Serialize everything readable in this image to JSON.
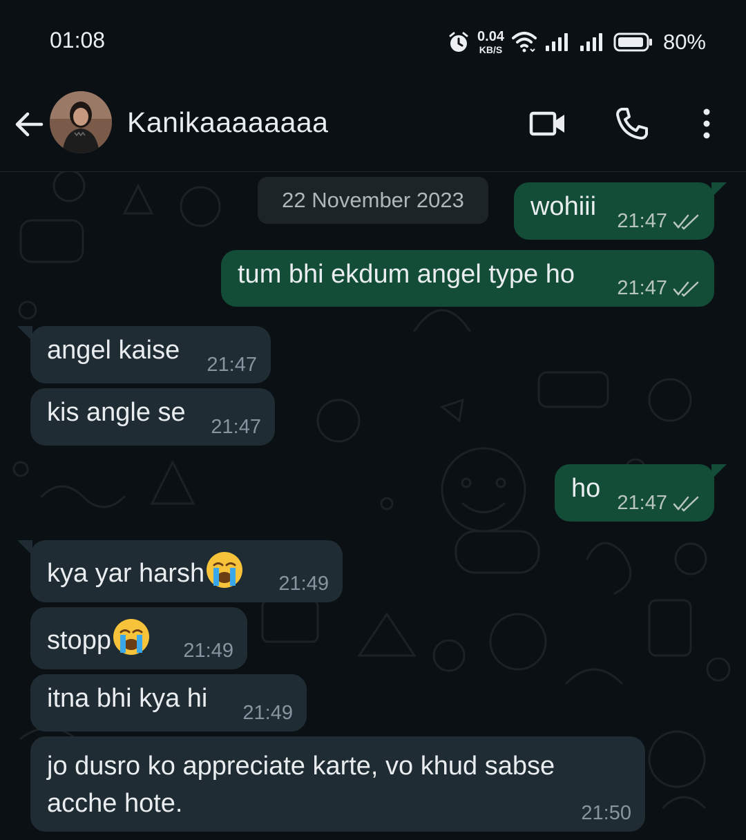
{
  "status": {
    "time": "01:08",
    "speed_value": "0.04",
    "speed_unit": "KB/S",
    "battery": "80%",
    "icons": [
      "alarm-icon",
      "wifi-icon",
      "signal-icon",
      "signal-icon",
      "battery-icon"
    ]
  },
  "header": {
    "contact_name": "Kanikaaaaaaaa",
    "icons": [
      "back-arrow-icon",
      "avatar",
      "video-call-icon",
      "phone-icon",
      "more-options-icon"
    ]
  },
  "chat": {
    "date_label": "22 November 2023",
    "messages": [
      {
        "direction": "out",
        "text": "wohiii",
        "time": "21:47",
        "status": "read"
      },
      {
        "direction": "out",
        "text": "tum bhi ekdum angel type ho",
        "time": "21:47",
        "status": "read"
      },
      {
        "direction": "in",
        "text": "angel kaise",
        "time": "21:47"
      },
      {
        "direction": "in",
        "text": "kis angle se",
        "time": "21:47"
      },
      {
        "direction": "out",
        "text": "ho",
        "time": "21:47",
        "status": "read"
      },
      {
        "direction": "in",
        "text": "kya yar harsh",
        "emoji": "loudly-crying-face",
        "time": "21:49"
      },
      {
        "direction": "in",
        "text": "stopp",
        "emoji": "loudly-crying-face",
        "time": "21:49"
      },
      {
        "direction": "in",
        "text": "itna bhi kya hi",
        "time": "21:49"
      },
      {
        "direction": "in",
        "text": "jo dusro ko appreciate karte, vo khud sabse acche hote.",
        "time": "21:50"
      }
    ]
  },
  "colors": {
    "background": "#0b1014",
    "outgoing_bubble": "#134d37",
    "incoming_bubble": "#202c33",
    "read_ticks": "#b9c6bf"
  }
}
